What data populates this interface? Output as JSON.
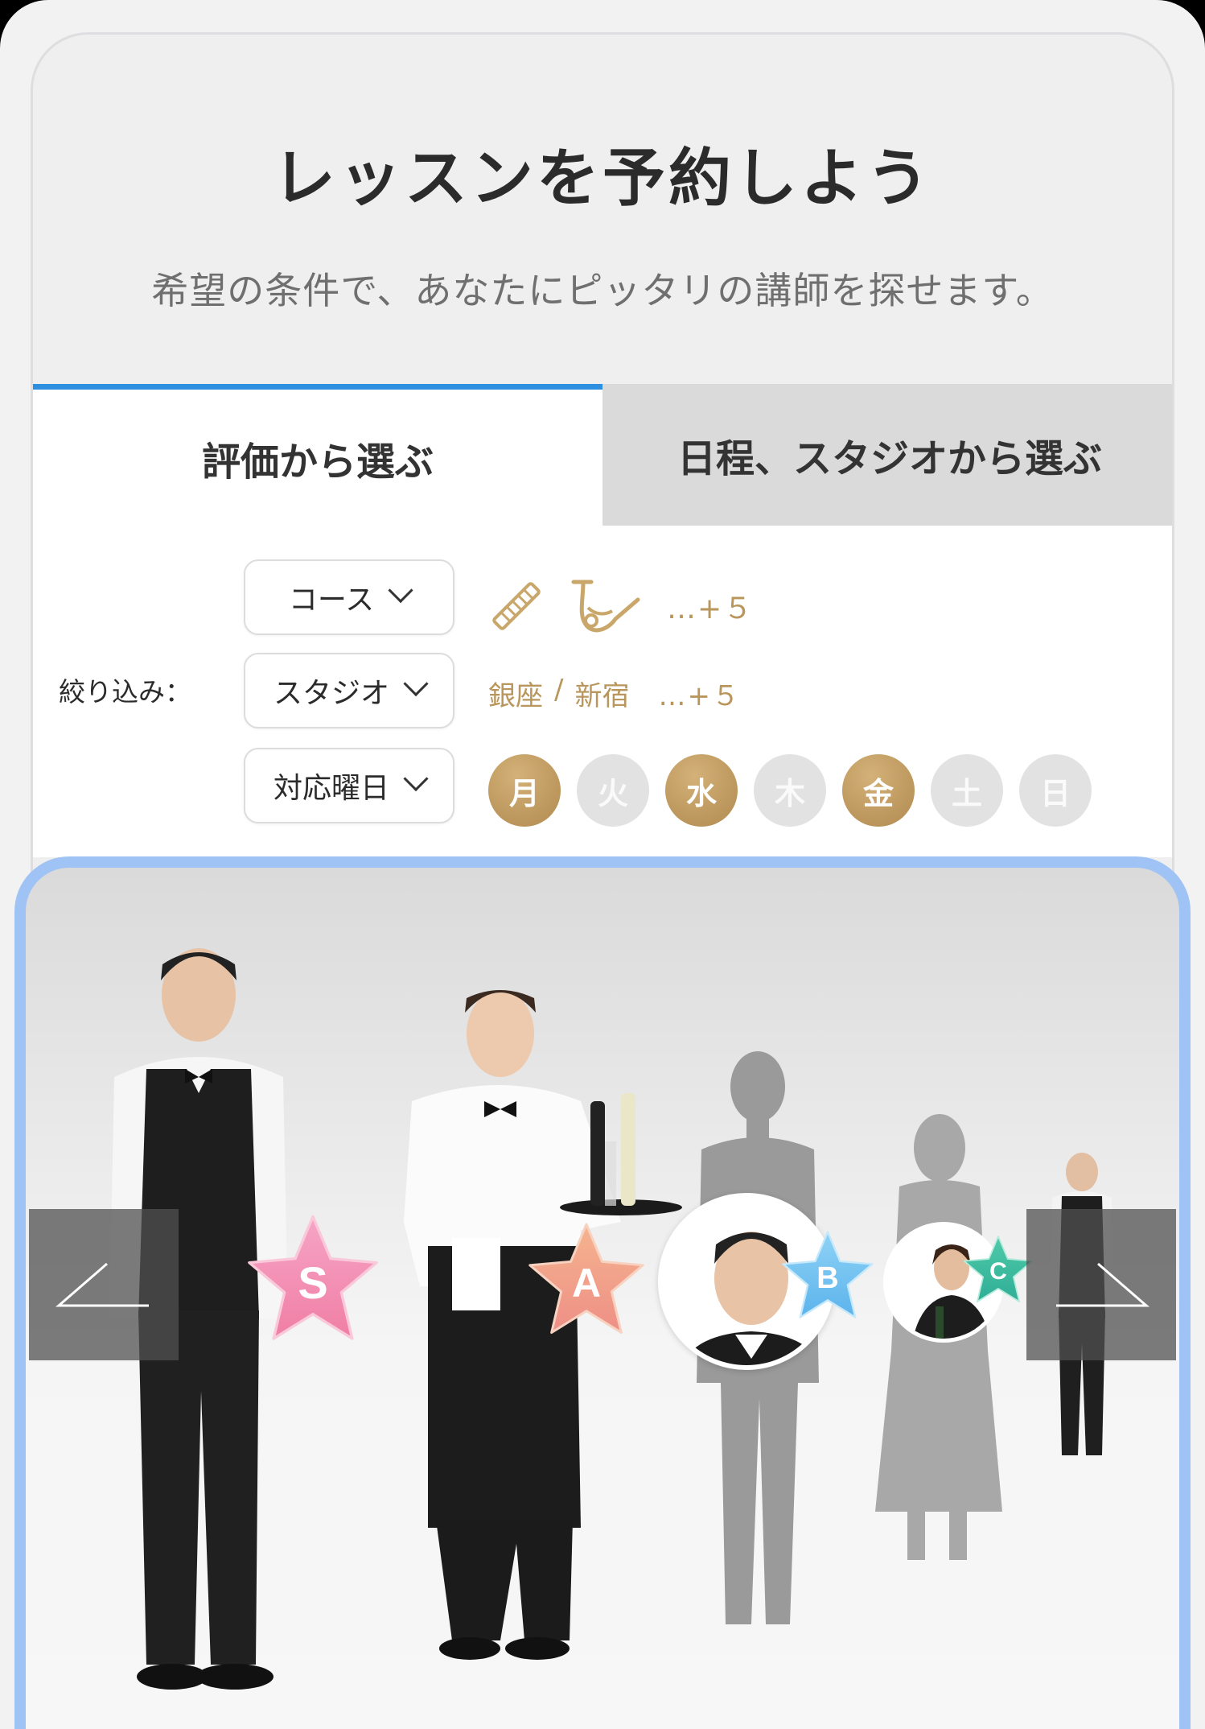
{
  "header": {
    "title": "レッスンを予約しよう",
    "subtitle": "希望の条件で、あなたにピッタリの講師を探せます。"
  },
  "tabs": [
    {
      "label": "評価から選ぶ",
      "active": true
    },
    {
      "label": "日程、スタジオから選ぶ",
      "active": false
    }
  ],
  "filters": {
    "label": "絞り込み：",
    "course": {
      "label": "コース",
      "icons": [
        "flute-icon",
        "saxophone-icon"
      ],
      "more": "…+５"
    },
    "studio": {
      "label": "スタジオ",
      "value_1": "銀座",
      "separator": "/",
      "value_2": "新宿",
      "more": "…+５"
    },
    "weekday": {
      "label": "対応曜日",
      "days": [
        {
          "label": "月",
          "selected": true
        },
        {
          "label": "火",
          "selected": false
        },
        {
          "label": "水",
          "selected": true
        },
        {
          "label": "木",
          "selected": false
        },
        {
          "label": "金",
          "selected": true
        },
        {
          "label": "土",
          "selected": false
        },
        {
          "label": "日",
          "selected": false
        }
      ]
    }
  },
  "instructors": {
    "ranks": [
      "S",
      "A",
      "B",
      "C"
    ],
    "rank_colors": {
      "S": "#f38fb0",
      "A": "#f2a38a",
      "B": "#6fc3ee",
      "C": "#3dbb9f"
    }
  },
  "colors": {
    "accent": "#2e8fe0",
    "gold": "#b9965b",
    "frame": "#9fc3f4"
  }
}
